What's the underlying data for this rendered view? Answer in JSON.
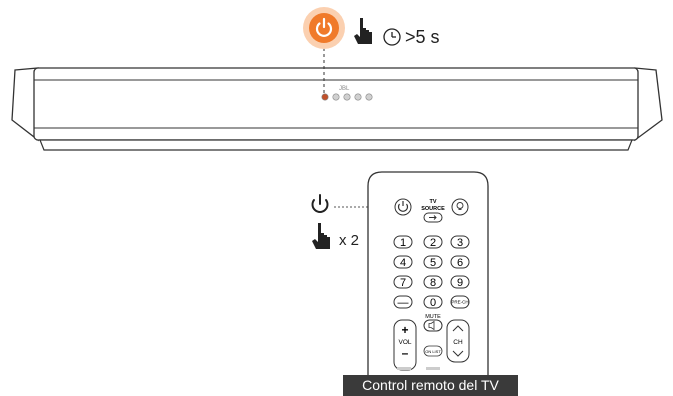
{
  "step1": {
    "power_icon": "power-icon",
    "hand_icon": "hand-press-icon",
    "clock_icon": "clock-icon",
    "duration_label": ">5 s",
    "power_color": "#f07a2a"
  },
  "soundbar": {
    "logo_text": "JBL",
    "indicator_active_color": "#c0502a",
    "indicator_inactive_color": "#d0d0d0",
    "indicator_count": 5
  },
  "step2": {
    "power_icon": "power-icon",
    "hand_icon": "hand-press-icon",
    "press_count_label": "x 2"
  },
  "remote": {
    "tv_source_label_line1": "TV",
    "tv_source_label_line2": "SOURCE",
    "number_keys": [
      "1",
      "2",
      "3",
      "4",
      "5",
      "6",
      "7",
      "8",
      "9",
      "—",
      "0",
      "PRE-CH"
    ],
    "mute_label": "MUTE",
    "vol_label": "VOL",
    "ch_label": "CH",
    "center_small_label": "ON LIST"
  },
  "caption": "Control remoto del TV"
}
